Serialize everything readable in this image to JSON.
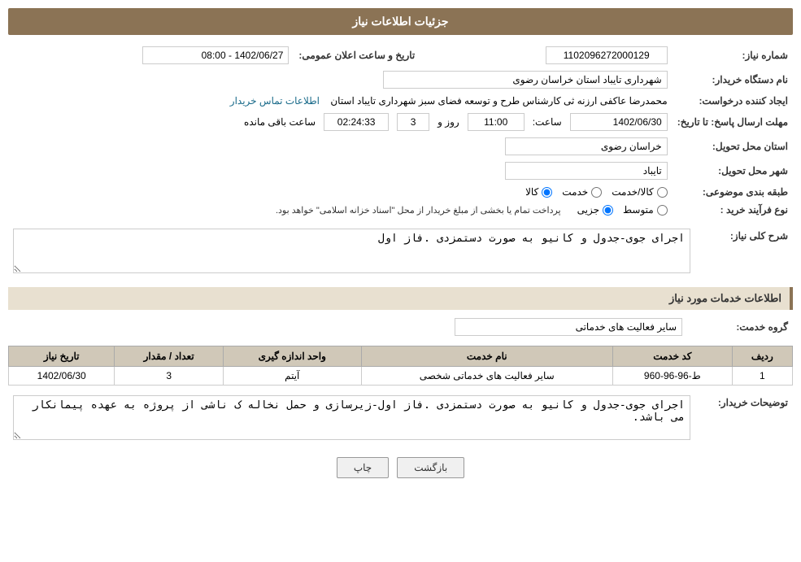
{
  "page": {
    "title": "جزئیات اطلاعات نیاز"
  },
  "header": {
    "title": "جزئیات اطلاعات نیاز"
  },
  "fields": {
    "need_number_label": "شماره نیاز:",
    "need_number_value": "1102096272000129",
    "buyer_org_label": "نام دستگاه خریدار:",
    "buyer_org_value": "شهرداری تایباد استان خراسان رضوی",
    "requester_label": "ایجاد کننده درخواست:",
    "requester_value": "محمدرضا عاکفی ارزنه ثی کارشناس طرح و توسعه فضای سبز شهرداری تایباد استان",
    "contact_label": "اطلاعات تماس خریدار",
    "response_deadline_label": "مهلت ارسال پاسخ: تا تاریخ:",
    "response_date_value": "1402/06/30",
    "response_time_label": "ساعت:",
    "response_time_value": "11:00",
    "days_label": "روز و",
    "days_value": "3",
    "remaining_label": "ساعت باقی مانده",
    "remaining_time": "02:24:33",
    "announce_datetime_label": "تاریخ و ساعت اعلان عمومی:",
    "announce_datetime_value": "1402/06/27 - 08:00",
    "province_label": "استان محل تحویل:",
    "province_value": "خراسان رضوی",
    "city_label": "شهر محل تحویل:",
    "city_value": "تایباد",
    "category_label": "طبقه بندی موضوعی:",
    "category_options": [
      "کالا",
      "خدمت",
      "کالا/خدمت"
    ],
    "category_selected": "کالا",
    "purchase_type_label": "نوع فرآیند خرید :",
    "purchase_options": [
      "جزیی",
      "متوسط"
    ],
    "purchase_notice": "پرداخت تمام یا بخشی از مبلغ خریدار از محل \"اسناد خزانه اسلامی\" خواهد بود."
  },
  "need_description": {
    "section_label": "شرح کلی نیاز:",
    "value": "اجرای جوی-جدول و کانیو به صورت دستمزدی .فاز اول"
  },
  "services_section": {
    "section_label": "اطلاعات خدمات مورد نیاز",
    "group_label": "گروه خدمت:",
    "group_value": "سایر فعالیت های خدماتی",
    "table": {
      "columns": [
        "ردیف",
        "کد خدمت",
        "نام خدمت",
        "واحد اندازه گیری",
        "تعداد / مقدار",
        "تاریخ نیاز"
      ],
      "rows": [
        {
          "row_num": "1",
          "service_code": "ط-96-96-960",
          "service_name": "سایر فعالیت های خدماتی شخصی",
          "unit": "آیتم",
          "quantity": "3",
          "need_date": "1402/06/30"
        }
      ]
    }
  },
  "buyer_description": {
    "section_label": "توضیحات خریدار:",
    "value": "اجرای جوی-جدول و کانیو به صورت دستمزدی .فاز اول-زیرسازی و حمل نخاله ک ناشی از پروژه به عهده پیمانکار می باشد."
  },
  "buttons": {
    "print_label": "چاپ",
    "back_label": "بازگشت"
  }
}
